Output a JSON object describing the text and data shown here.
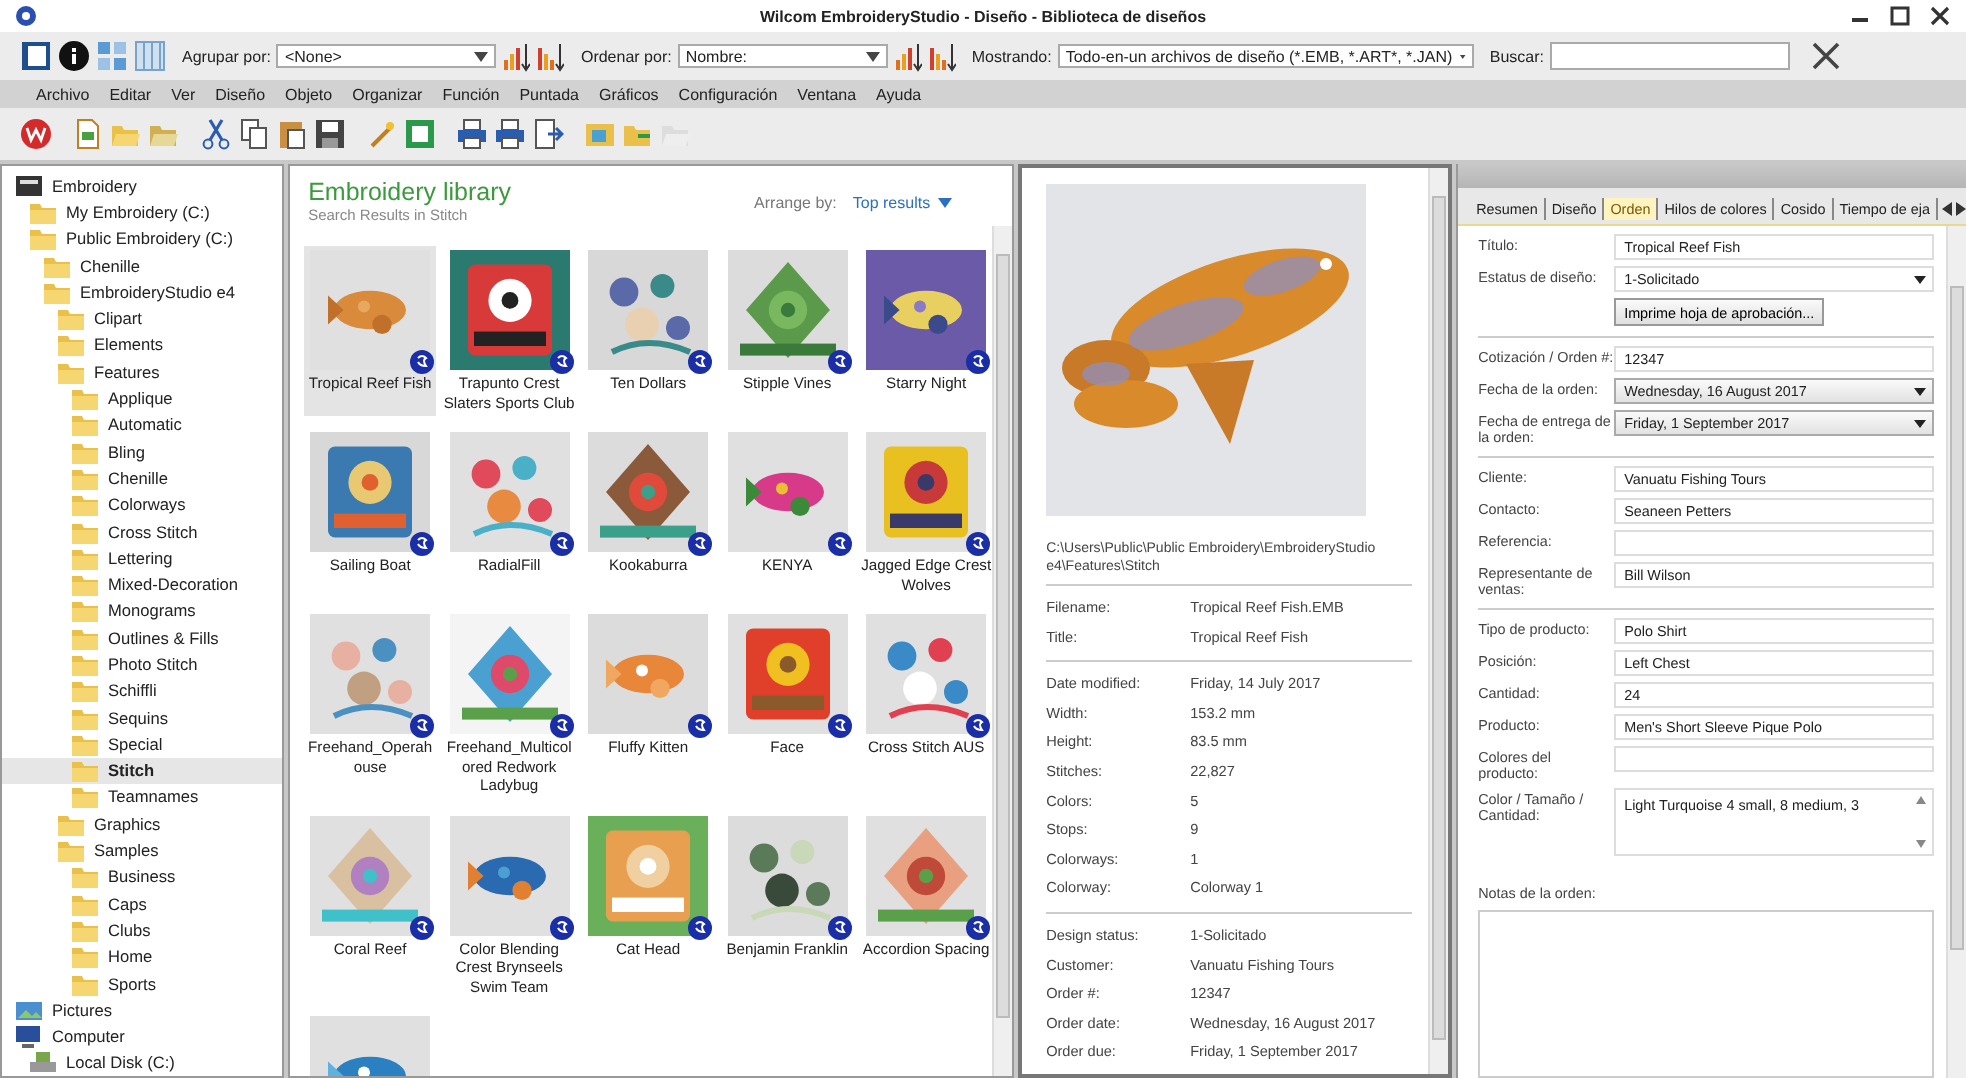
{
  "window": {
    "title": "Wilcom EmbroideryStudio - Diseño - Biblioteca de diseños"
  },
  "toolbar": {
    "group_by": {
      "label": "Agrupar por:",
      "value": "<None>"
    },
    "sort_by": {
      "label": "Ordenar por:",
      "value": "Nombre:"
    },
    "showing": {
      "label": "Mostrando:",
      "value": "Todo-en-un archivos de diseño (*.EMB, *.ART*, *.JAN)"
    },
    "search": {
      "label": "Buscar:"
    }
  },
  "menu": [
    "Archivo",
    "Editar",
    "Ver",
    "Diseño",
    "Objeto",
    "Organizar",
    "Función",
    "Puntada",
    "Gráficos",
    "Configuración",
    "Ventana",
    "Ayuda"
  ],
  "tree": [
    {
      "label": "Embroidery",
      "kind": "embroidery",
      "selected": false,
      "children": [
        {
          "label": "My Embroidery (C:)",
          "kind": "folder",
          "selected": false
        },
        {
          "label": "Public Embroidery (C:)",
          "kind": "folder",
          "selected": false,
          "children": [
            {
              "label": "Chenille",
              "kind": "folder",
              "selected": false
            },
            {
              "label": "EmbroideryStudio e4",
              "kind": "folder",
              "selected": false,
              "children": [
                {
                  "label": "Clipart",
                  "kind": "folder",
                  "selected": false
                },
                {
                  "label": "Elements",
                  "kind": "folder",
                  "selected": false
                },
                {
                  "label": "Features",
                  "kind": "folder",
                  "selected": false,
                  "children": [
                    {
                      "label": "Applique",
                      "kind": "folder",
                      "selected": false
                    },
                    {
                      "label": "Automatic",
                      "kind": "folder",
                      "selected": false
                    },
                    {
                      "label": "Bling",
                      "kind": "folder",
                      "selected": false
                    },
                    {
                      "label": "Chenille",
                      "kind": "folder",
                      "selected": false
                    },
                    {
                      "label": "Colorways",
                      "kind": "folder",
                      "selected": false
                    },
                    {
                      "label": "Cross Stitch",
                      "kind": "folder",
                      "selected": false
                    },
                    {
                      "label": "Lettering",
                      "kind": "folder",
                      "selected": false
                    },
                    {
                      "label": "Mixed-Decoration",
                      "kind": "folder",
                      "selected": false
                    },
                    {
                      "label": "Monograms",
                      "kind": "folder",
                      "selected": false
                    },
                    {
                      "label": "Outlines & Fills",
                      "kind": "folder",
                      "selected": false
                    },
                    {
                      "label": "Photo Stitch",
                      "kind": "folder",
                      "selected": false
                    },
                    {
                      "label": "Schiffli",
                      "kind": "folder",
                      "selected": false
                    },
                    {
                      "label": "Sequins",
                      "kind": "folder",
                      "selected": false
                    },
                    {
                      "label": "Special",
                      "kind": "folder",
                      "selected": false
                    },
                    {
                      "label": "Stitch",
                      "kind": "folder",
                      "selected": true
                    },
                    {
                      "label": "Teamnames",
                      "kind": "folder",
                      "selected": false
                    }
                  ]
                },
                {
                  "label": "Graphics",
                  "kind": "folder",
                  "selected": false
                },
                {
                  "label": "Samples",
                  "kind": "folder",
                  "selected": false,
                  "children": [
                    {
                      "label": "Business",
                      "kind": "folder",
                      "selected": false
                    },
                    {
                      "label": "Caps",
                      "kind": "folder",
                      "selected": false
                    },
                    {
                      "label": "Clubs",
                      "kind": "folder",
                      "selected": false
                    },
                    {
                      "label": "Home",
                      "kind": "folder",
                      "selected": false
                    },
                    {
                      "label": "Sports",
                      "kind": "folder",
                      "selected": false
                    }
                  ]
                }
              ]
            }
          ]
        }
      ]
    },
    {
      "label": "Pictures",
      "kind": "pictures",
      "selected": false
    },
    {
      "label": "Computer",
      "kind": "computer",
      "selected": false,
      "children": [
        {
          "label": "Local Disk (C:)",
          "kind": "disk",
          "selected": false
        }
      ]
    }
  ],
  "library": {
    "title": "Embroidery library",
    "subtitle": "Search Results in Stitch",
    "arrange_label": "Arrange by:",
    "arrange_value": "Top results",
    "designs": [
      {
        "name": "Tropical Reef Fish",
        "selected": true
      },
      {
        "name": "Trapunto Crest Slaters Sports Club",
        "selected": false
      },
      {
        "name": "Ten Dollars",
        "selected": false
      },
      {
        "name": "Stipple Vines",
        "selected": false
      },
      {
        "name": "Starry Night",
        "selected": false
      },
      {
        "name": "Sailing Boat",
        "selected": false
      },
      {
        "name": "RadialFill",
        "selected": false
      },
      {
        "name": "Kookaburra",
        "selected": false
      },
      {
        "name": "KENYA",
        "selected": false
      },
      {
        "name": "Jagged Edge Crest Wolves",
        "selected": false
      },
      {
        "name": "Freehand_Operahouse",
        "selected": false
      },
      {
        "name": "Freehand_Multicolored Redwork Ladybug",
        "selected": false
      },
      {
        "name": "Fluffy Kitten",
        "selected": false
      },
      {
        "name": "Face",
        "selected": false
      },
      {
        "name": "Cross Stitch AUS",
        "selected": false
      },
      {
        "name": "Coral Reef",
        "selected": false
      },
      {
        "name": "Color Blending Crest Brynseels Swim Team",
        "selected": false
      },
      {
        "name": "Cat Head",
        "selected": false
      },
      {
        "name": "Benjamin Franklin",
        "selected": false
      },
      {
        "name": "Accordion Spacing",
        "selected": false
      },
      {
        "selected": false
      }
    ]
  },
  "details": {
    "path": "C:\\Users\\Public\\Public Embroidery\\EmbroideryStudio e4\\Features\\Stitch",
    "groups": [
      [
        {
          "label": "Filename:",
          "value": "Tropical Reef Fish.EMB"
        },
        {
          "label": "Title:",
          "value": "Tropical Reef Fish"
        }
      ],
      [
        {
          "label": "Date modified:",
          "value": "Friday, 14 July 2017"
        },
        {
          "label": "Width:",
          "value": "153.2 mm"
        },
        {
          "label": "Height:",
          "value": "83.5 mm"
        },
        {
          "label": "Stitches:",
          "value": "22,827"
        },
        {
          "label": "Colors:",
          "value": "5"
        },
        {
          "label": "Stops:",
          "value": "9"
        },
        {
          "label": "Colorways:",
          "value": "1"
        },
        {
          "label": "Colorway:",
          "value": "Colorway 1"
        }
      ],
      [
        {
          "label": "Design status:",
          "value": "1-Solicitado"
        },
        {
          "label": "Customer:",
          "value": "Vanuatu Fishing Tours"
        },
        {
          "label": "Order #:",
          "value": "12347"
        },
        {
          "label": "Order date:",
          "value": "Wednesday, 16 August 2017"
        },
        {
          "label": "Order due:",
          "value": "Friday, 1 September 2017"
        }
      ]
    ]
  },
  "properties": {
    "tabs": [
      {
        "label": "Resumen",
        "selected": false
      },
      {
        "label": "Diseño",
        "selected": false
      },
      {
        "label": "Orden",
        "selected": true
      },
      {
        "label": "Hilos de colores",
        "selected": false
      },
      {
        "label": "Cosido",
        "selected": false
      },
      {
        "label": "Tiempo de eja",
        "selected": false
      }
    ],
    "sections": [
      [
        {
          "label": "Título:",
          "kind": "text",
          "value": "Tropical Reef Fish"
        },
        {
          "label": "Estatus de diseño:",
          "kind": "dropdown",
          "value": "1-Solicitado"
        },
        {
          "kind": "button",
          "value": "Imprime hoja de aprobación..."
        }
      ],
      [
        {
          "label": "Cotización / Orden #:",
          "kind": "text",
          "value": "12347"
        },
        {
          "label": "Fecha de la orden:",
          "kind": "date",
          "value": "Wednesday, 16 August 2017"
        },
        {
          "label": "Fecha de entrega de la orden:",
          "kind": "date",
          "value": "Friday, 1 September 2017"
        }
      ],
      [
        {
          "label": "Cliente:",
          "kind": "text",
          "value": "Vanuatu Fishing Tours"
        },
        {
          "label": "Contacto:",
          "kind": "text",
          "value": "Seaneen Petters"
        },
        {
          "label": "Referencia:",
          "kind": "text"
        },
        {
          "label": "Representante de ventas:",
          "kind": "text",
          "value": "Bill Wilson"
        }
      ],
      [
        {
          "label": "Tipo de producto:",
          "kind": "text",
          "value": "Polo Shirt"
        },
        {
          "label": "Posición:",
          "kind": "text",
          "value": "Left Chest"
        },
        {
          "label": "Cantidad:",
          "kind": "text",
          "value": "24"
        },
        {
          "label": "Producto:",
          "kind": "text",
          "value": "Men's Short Sleeve Pique Polo"
        },
        {
          "label": "Colores del producto:",
          "kind": "text"
        },
        {
          "label": "Color / Tamaño / Cantidad:",
          "kind": "multiline",
          "value": "Light Turquoise 4 small, 8 medium, 3"
        }
      ]
    ],
    "notes_label": "Notas de la orden:"
  }
}
